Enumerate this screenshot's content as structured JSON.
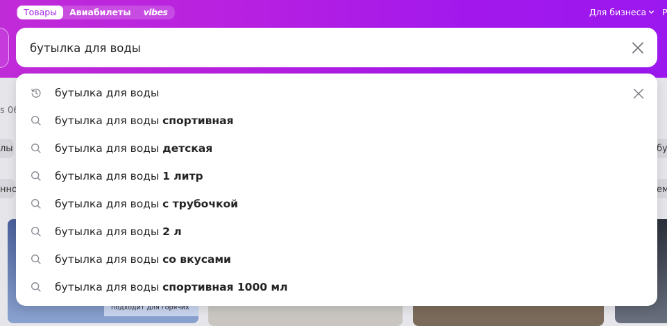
{
  "header": {
    "tabs": [
      {
        "label": "Товары",
        "active": true
      },
      {
        "label": "Авиабилеты",
        "active": false
      },
      {
        "label": "vibes",
        "active": false
      }
    ],
    "for_business": "Для бизнеса",
    "cut_right": "Р"
  },
  "search": {
    "value": "бутылка для воды",
    "clear_icon": "close-icon"
  },
  "background": {
    "left_text_1": "s 06",
    "left_text_2": "лы",
    "left_text_3": "ннос",
    "right_text_1": "бу",
    "right_text_2": "ем",
    "card_text": "подходит для горячих"
  },
  "suggestions": [
    {
      "base": "бутылка для воды",
      "bold": "",
      "icon": "history-icon",
      "removable": true
    },
    {
      "base": "бутылка для воды ",
      "bold": "спортивная",
      "icon": "search-icon",
      "removable": false
    },
    {
      "base": "бутылка для воды ",
      "bold": "детская",
      "icon": "search-icon",
      "removable": false
    },
    {
      "base": "бутылка для воды ",
      "bold": "1 литр",
      "icon": "search-icon",
      "removable": false
    },
    {
      "base": "бутылка для воды ",
      "bold": "с трубочкой",
      "icon": "search-icon",
      "removable": false
    },
    {
      "base": "бутылка для воды ",
      "bold": "2 л",
      "icon": "search-icon",
      "removable": false
    },
    {
      "base": "бутылка для воды ",
      "bold": "со вкусами",
      "icon": "search-icon",
      "removable": false
    },
    {
      "base": "бутылка для воды ",
      "bold": "спортивная 1000 мл",
      "icon": "search-icon",
      "removable": false
    }
  ],
  "colors": {
    "brand_gradient_start": "#c02bd8",
    "brand_gradient_end": "#9b18ee",
    "text": "#242424"
  }
}
